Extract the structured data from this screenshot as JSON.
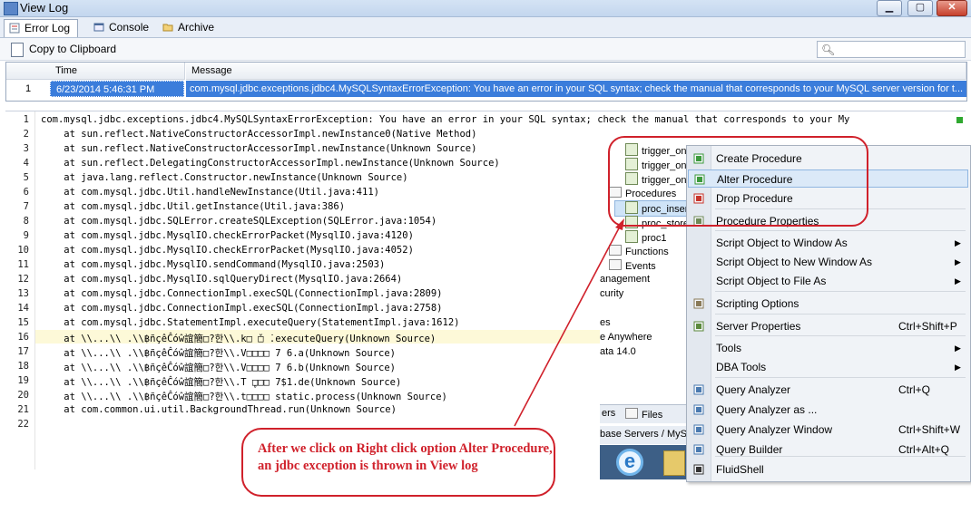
{
  "window": {
    "title": "View Log",
    "minimize": "▁",
    "maximize": "▢",
    "close": "✕"
  },
  "tabs": [
    {
      "label": "Error Log",
      "icon": "error-log-icon",
      "active": true
    },
    {
      "label": "Console",
      "icon": "console-icon",
      "active": false
    },
    {
      "label": "Archive",
      "icon": "folder-icon",
      "active": false
    }
  ],
  "toolbar": {
    "copy_label": "Copy to Clipboard",
    "search_placeholder": ""
  },
  "grid": {
    "headers": [
      "Time",
      "Message"
    ],
    "rows": [
      {
        "num": "1",
        "time": "6/23/2014 5:46:31 PM",
        "message": "com.mysql.jdbc.exceptions.jdbc4.MySQLSyntaxErrorException: You have an error in your SQL syntax; check the manual that corresponds to your MySQL server version for t..."
      }
    ]
  },
  "log": {
    "lines": [
      "com.mysql.jdbc.exceptions.jdbc4.MySQLSyntaxErrorException: You have an error in your SQL syntax; check the manual that corresponds to your My",
      "    at sun.reflect.NativeConstructorAccessorImpl.newInstance0(Native Method)",
      "    at sun.reflect.NativeConstructorAccessorImpl.newInstance(Unknown Source)",
      "    at sun.reflect.DelegatingConstructorAccessorImpl.newInstance(Unknown Source)",
      "    at java.lang.reflect.Constructor.newInstance(Unknown Source)",
      "    at com.mysql.jdbc.Util.handleNewInstance(Util.java:411)",
      "    at com.mysql.jdbc.Util.getInstance(Util.java:386)",
      "    at com.mysql.jdbc.SQLError.createSQLException(SQLError.java:1054)",
      "    at com.mysql.jdbc.MysqlIO.checkErrorPacket(MysqlIO.java:4120)",
      "    at com.mysql.jdbc.MysqlIO.checkErrorPacket(MysqlIO.java:4052)",
      "    at com.mysql.jdbc.MysqlIO.sendCommand(MysqlIO.java:2503)",
      "    at com.mysql.jdbc.MysqlIO.sqlQueryDirect(MysqlIO.java:2664)",
      "    at com.mysql.jdbc.ConnectionImpl.execSQL(ConnectionImpl.java:2809)",
      "    at com.mysql.jdbc.ConnectionImpl.execSQL(ConnectionImpl.java:2758)",
      "    at com.mysql.jdbc.StatementImpl.executeQuery(StatementImpl.java:1612)",
      "    at \\\\...\\\\ .\\\\฿ñçêĈóŵ誼簡□?한\\\\.k□ ̌□ ̇.executeQuery(Unknown Source)",
      "    at \\\\...\\\\ .\\\\฿ñçêĈóŵ誼簡□?한\\\\.V□□□□ 7 6.a(Unknown Source)",
      "    at \\\\...\\\\ .\\\\฿ñçêĈóŵ誼簡□?한\\\\.V□□□□ 7 6.b(Unknown Source)",
      "    at \\\\...\\\\ .\\\\฿ñçêĈóŵ誼簡□?한\\\\.T ̥□□□ 7$1.de(Unknown Source)",
      "    at \\\\...\\\\ .\\\\฿ñçêĈóŵ誼簡□?한\\\\.t□□□□ static.process(Unknown Source)",
      "    at com.common.ui.util.BackgroundThread.run(Unknown Source)",
      ""
    ]
  },
  "tree": {
    "items": [
      "trigger_on",
      "trigger_on",
      "trigger_on",
      "Procedures",
      "proc_inser",
      "proc_store",
      "proc1",
      "Functions",
      "Events",
      "anagement",
      "curity",
      "es",
      "e Anywhere",
      "ata 14.0"
    ],
    "bottom_tabs": [
      "ers",
      "Files"
    ],
    "bottom_text": "base Servers / MyS"
  },
  "menu": {
    "items": [
      {
        "label": "Create Procedure",
        "shortcut": "",
        "icon": "create-procedure-icon"
      },
      {
        "label": "Alter Procedure",
        "shortcut": "",
        "icon": "alter-procedure-icon"
      },
      {
        "label": "Drop Procedure",
        "shortcut": "",
        "icon": "drop-procedure-icon"
      },
      {
        "label": "Procedure Properties",
        "shortcut": "",
        "icon": "procedure-properties-icon"
      },
      {
        "label": "Script Object to Window As",
        "shortcut": "",
        "icon": ""
      },
      {
        "label": "Script Object to New Window As",
        "shortcut": "",
        "icon": ""
      },
      {
        "label": "Script Object to File As",
        "shortcut": "",
        "icon": ""
      },
      {
        "label": "Scripting Options",
        "shortcut": "",
        "icon": "scripting-options-icon"
      },
      {
        "label": "Server Properties",
        "shortcut": "Ctrl+Shift+P",
        "icon": "server-properties-icon"
      },
      {
        "label": "Tools",
        "shortcut": "",
        "icon": ""
      },
      {
        "label": "DBA Tools",
        "shortcut": "",
        "icon": ""
      },
      {
        "label": "Query Analyzer",
        "shortcut": "Ctrl+Q",
        "icon": "query-analyzer-icon"
      },
      {
        "label": "Query Analyzer as ...",
        "shortcut": "",
        "icon": "query-analyzer-as-icon"
      },
      {
        "label": "Query Analyzer Window",
        "shortcut": "Ctrl+Shift+W",
        "icon": "query-analyzer-window-icon"
      },
      {
        "label": "Query Builder",
        "shortcut": "Ctrl+Alt+Q",
        "icon": "query-builder-icon"
      },
      {
        "label": "FluidShell",
        "shortcut": "",
        "icon": "fluidshell-icon"
      }
    ],
    "submenu_arrow": "▶"
  },
  "annotation": {
    "text": "After we click on Right click option Alter Procedure, an jdbc exception is thrown in View log",
    "color": "#d0212b"
  },
  "colors": {
    "selection": "#3b7ddb",
    "highlight_line": "#fdf9d8",
    "menu_hover": "#dbe9f8"
  }
}
